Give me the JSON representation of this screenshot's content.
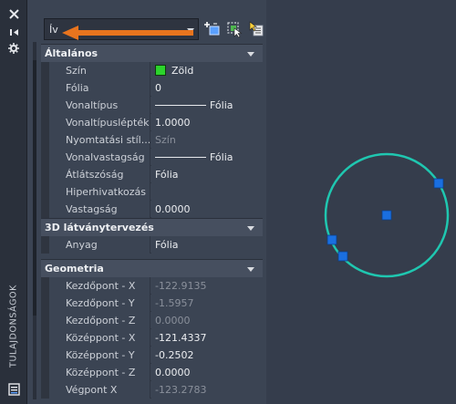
{
  "strip": {
    "title": "TULAJDONSÁGOK",
    "icons": [
      "close-icon",
      "autohide-icon",
      "settings-icon",
      "properties-icon"
    ]
  },
  "selector": {
    "value": "Ív",
    "icons": [
      "quick-select-icon",
      "select-objects-icon",
      "pickadd-toggle-icon"
    ]
  },
  "sections": {
    "general": {
      "title": "Általános",
      "rows": [
        {
          "label": "Szín",
          "value": "Zöld",
          "swatch": "#2cd32c"
        },
        {
          "label": "Fólia",
          "value": "0"
        },
        {
          "label": "Vonaltípus",
          "value": "Fólia"
        },
        {
          "label": "Vonaltípuslépték",
          "value": "1.0000"
        },
        {
          "label": "Nyomtatási stíl...",
          "value": "Szín"
        },
        {
          "label": "Vonalvastagság",
          "value": "Fólia"
        },
        {
          "label": "Átlátszóság",
          "value": "Fólia"
        },
        {
          "label": "Hiperhivatkozás",
          "value": ""
        },
        {
          "label": "Vastagság",
          "value": "0.0000"
        }
      ]
    },
    "viz3d": {
      "title": "3D látványtervezés",
      "rows": [
        {
          "label": "Anyag",
          "value": "Fólia"
        }
      ]
    },
    "geometry": {
      "title": "Geometria",
      "rows": [
        {
          "label": "Kezdőpont - X",
          "value": "-122.9135"
        },
        {
          "label": "Kezdőpont - Y",
          "value": "-1.5957"
        },
        {
          "label": "Kezdőpont - Z",
          "value": "0.0000"
        },
        {
          "label": "Középpont - X",
          "value": "-121.4337"
        },
        {
          "label": "Középpont - Y",
          "value": "-0.2502"
        },
        {
          "label": "Középpont - Z",
          "value": "0.0000"
        },
        {
          "label": "Végpont X",
          "value": "-123.2783"
        }
      ]
    }
  },
  "colors": {
    "arrow": "#e8741e",
    "circle": "#1fc7b0",
    "grip": "#1a6fe0"
  }
}
